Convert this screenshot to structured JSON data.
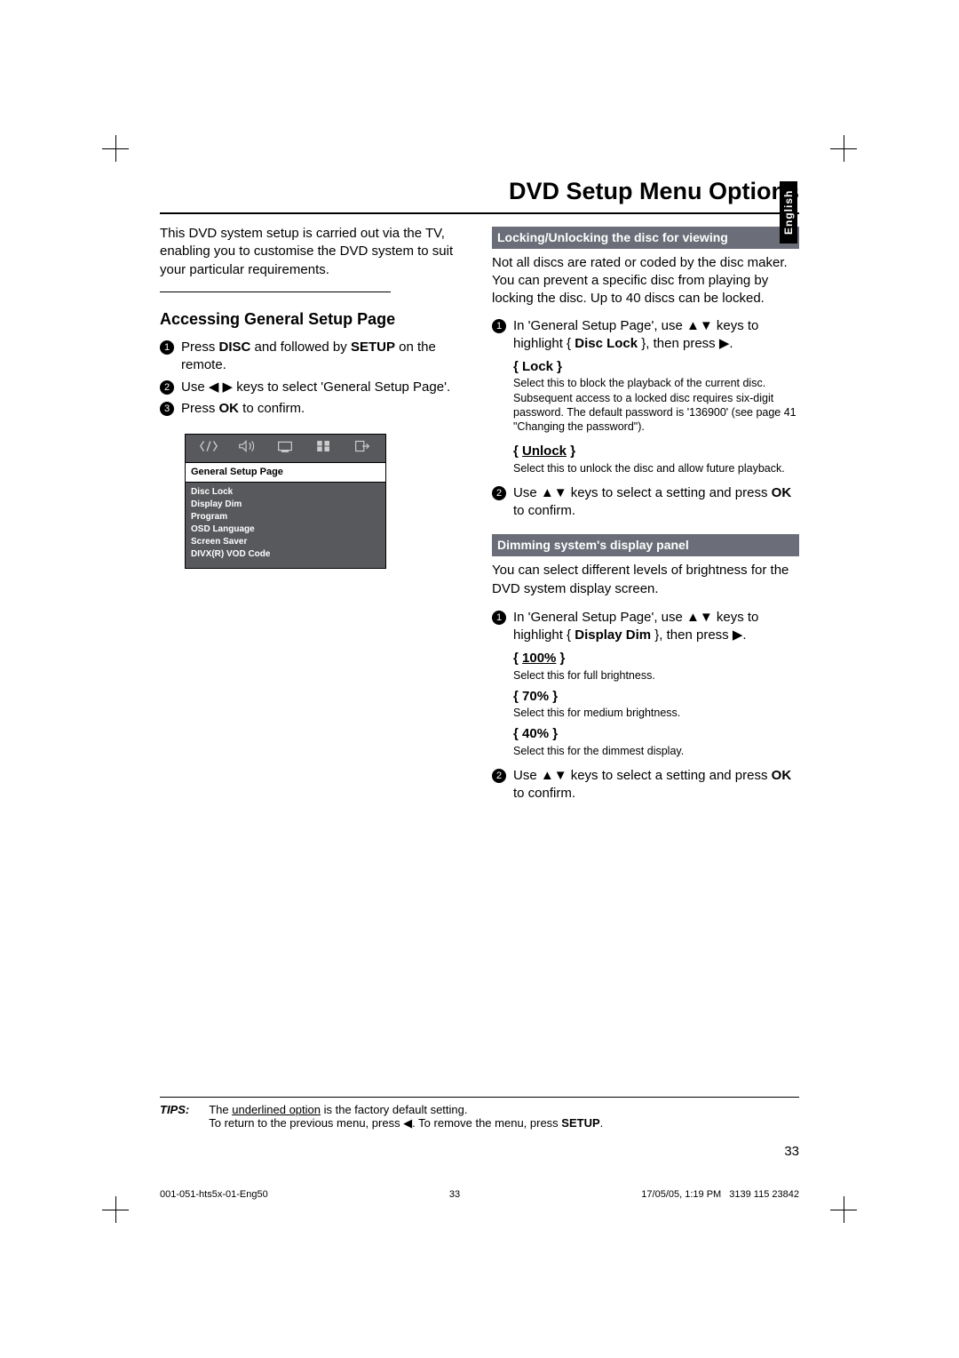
{
  "title": "DVD Setup Menu Options",
  "side_tab": "English",
  "intro": "This DVD system setup is carried out via the TV, enabling you to customise the DVD system to suit your particular requirements.",
  "left": {
    "heading": "Accessing General Setup Page",
    "steps": [
      {
        "num": "1",
        "pre": "Press ",
        "b1": "DISC",
        "mid": " and followed by ",
        "b2": "SETUP",
        "post": " on the remote."
      },
      {
        "num": "2",
        "pre": "Use ◀ ▶ keys to select 'General Setup Page'."
      },
      {
        "num": "3",
        "pre": "Press ",
        "b1": "OK",
        "post": " to confirm."
      }
    ],
    "menu": {
      "title": "General Setup Page",
      "items": [
        "Disc Lock",
        "Display Dim",
        "Program",
        "OSD Language",
        "Screen Saver",
        "DIVX(R) VOD Code"
      ]
    }
  },
  "right": {
    "sub1": "Locking/Unlocking the disc for viewing",
    "p1": "Not all discs are rated or coded by the disc maker. You can prevent a specific disc from playing by locking the disc. Up to 40 discs can be locked.",
    "step1_pre": "In 'General Setup Page', use ▲▼ keys to highlight { ",
    "step1_b": "Disc Lock",
    "step1_post": " }, then press ▶.",
    "lock_label": "{ Lock }",
    "lock_desc": "Select this to block the playback of the current disc. Subsequent access to a locked disc requires six-digit password. The default password is '136900' (see page 41 \"Changing the password\").",
    "unlock_label": "{ Unlock }",
    "unlock_desc": "Select this to unlock the disc and allow future playback.",
    "step2_pre": "Use ▲▼ keys to select a setting and press ",
    "step2_b": "OK",
    "step2_post": " to confirm.",
    "sub2": "Dimming system's display panel",
    "p2": "You can select different levels of brightness for the DVD system display screen.",
    "dim_step1_pre": "In 'General Setup Page', use ▲▼ keys to highlight { ",
    "dim_step1_b": "Display Dim",
    "dim_step1_post": " }, then press ▶.",
    "opt100_label": "{ 100% }",
    "opt100_desc": "Select this for full brightness.",
    "opt70_label": "{ 70% }",
    "opt70_desc": "Select this for medium brightness.",
    "opt40_label": "{ 40% }",
    "opt40_desc": "Select this for the dimmest display.",
    "dim_step2_pre": "Use ▲▼ keys to select a setting and press ",
    "dim_step2_b": "OK",
    "dim_step2_post": " to confirm."
  },
  "tips": {
    "label": "TIPS:",
    "line1a": "The ",
    "line1u": "underlined option",
    "line1b": " is the factory default setting.",
    "line2": "To return to the previous menu, press ◀. To remove the menu, press ",
    "line2b": "SETUP",
    "line2c": "."
  },
  "page_num": "33",
  "footer": {
    "left": "001-051-hts5x-01-Eng50",
    "center": "33",
    "right_a": "17/05/05, 1:19 PM",
    "right_b": "3139 115 23842"
  }
}
